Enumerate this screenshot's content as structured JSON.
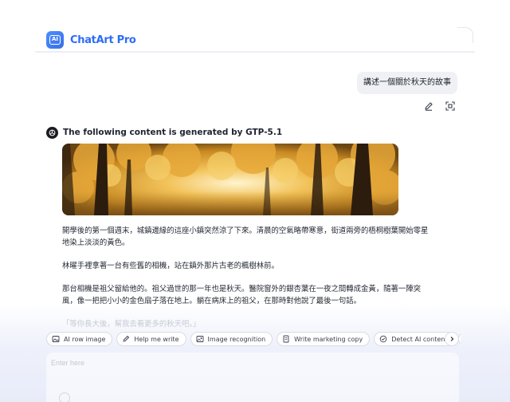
{
  "app": {
    "name": "ChatArt Pro",
    "logo_text": "AI"
  },
  "conversation": {
    "user_message": "講述一個關於秋天的故事",
    "model_label": "The following content is generated by GTP-5.1",
    "story_paragraphs": [
      "開學後的第一個週末，城鎮邊緣的這座小鎮突然涼了下來。清晨的空氣略帶寒意，街道兩旁的梧桐樹葉開始零星地染上淡淡的黃色。",
      "林曜手裡拿著一台有些舊的相機，站在鎮外那片古老的楓樹林前。",
      "那台相機是祖父留給他的。祖父過世的那一年也是秋天。醫院窗外的銀杏葉在一夜之間轉成金黃，隨著一陣突風，像一把把小小的金色扇子落在地上。躺在病床上的祖父，在那時對他說了最後一句話。",
      "「等你長大後，幫我去看更多的秋天吧。」"
    ]
  },
  "tools": [
    {
      "label": "AI row image",
      "icon": "image-icon"
    },
    {
      "label": "Help me write",
      "icon": "pen-icon"
    },
    {
      "label": "Image recognition",
      "icon": "scan-image-icon"
    },
    {
      "label": "Write marketing copy",
      "icon": "document-icon"
    },
    {
      "label": "Detect AI content",
      "icon": "check-circle-icon"
    },
    {
      "label": "",
      "icon": "link-icon"
    }
  ],
  "input": {
    "placeholder": "Enter here"
  },
  "colors": {
    "brand": "#2d6cf5",
    "autumn_gold": "#e3a735",
    "chip_border": "#d9dce5"
  }
}
